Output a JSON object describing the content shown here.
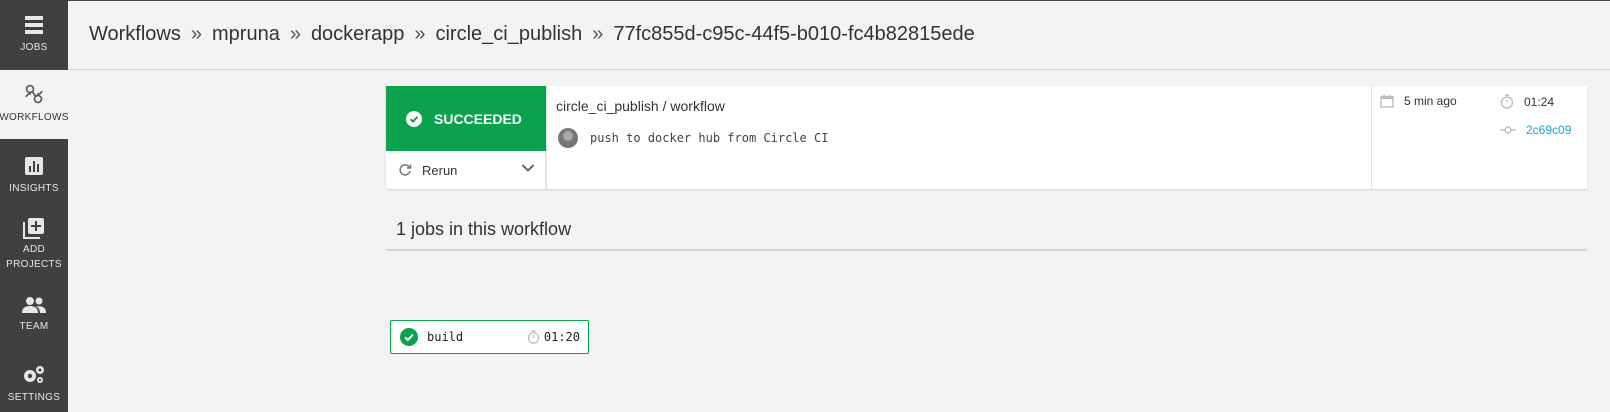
{
  "sidebar": {
    "items": [
      {
        "label": "JOBS",
        "icon": "jobs-icon"
      },
      {
        "label": "WORKFLOWS",
        "icon": "workflows-icon"
      },
      {
        "label": "INSIGHTS",
        "icon": "insights-icon"
      },
      {
        "label_line1": "ADD",
        "label_line2": "PROJECTS",
        "icon": "add-projects-icon"
      },
      {
        "label": "TEAM",
        "icon": "team-icon"
      },
      {
        "label": "SETTINGS",
        "icon": "settings-icon"
      }
    ],
    "active_index": 1
  },
  "breadcrumb": {
    "items": [
      "Workflows",
      "mpruna",
      "dockerapp",
      "circle_ci_publish",
      "77fc855d-c95c-44f5-b010-fc4b82815ede"
    ],
    "separator": "»"
  },
  "workflow": {
    "status": "SUCCEEDED",
    "rerun_label": "Rerun",
    "title": "circle_ci_publish / workflow",
    "commit_message": "push to docker hub from Circle CI",
    "time_ago": "5 min ago",
    "duration": "01:24",
    "commit_sha": "2c69c09"
  },
  "jobs": {
    "heading": "1 jobs in this workflow",
    "items": [
      {
        "name": "build",
        "duration": "01:20",
        "status": "success"
      }
    ]
  },
  "colors": {
    "success": "#0aa24c",
    "sidebar": "#404040",
    "link": "#1fa1c2"
  }
}
